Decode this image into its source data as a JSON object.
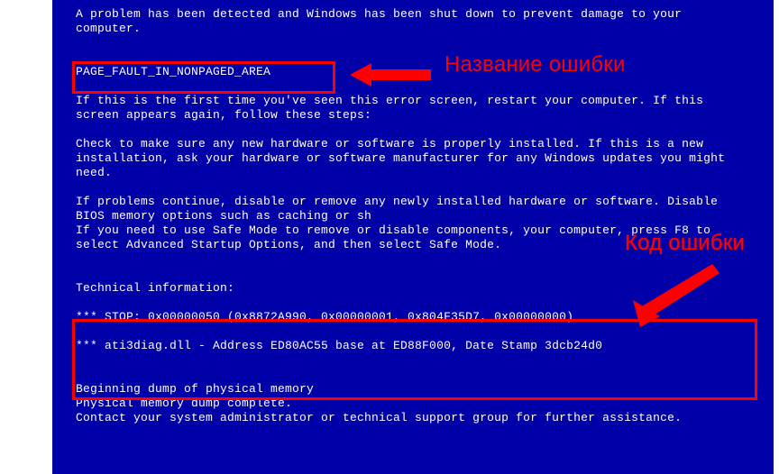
{
  "bsod": {
    "intro": "A problem has been detected and Windows has been shut down to prevent damage to your computer.",
    "error_name": "PAGE_FAULT_IN_NONPAGED_AREA",
    "first_time": "If this is the first time you've seen this error screen, restart your computer. If this screen appears again, follow these steps:",
    "check_hw": "Check to make sure any new hardware or software is properly installed. If this is a new installation, ask your hardware or software manufacturer for any Windows updates you might need.",
    "problems_continue": "If problems continue, disable or remove any newly installed hardware or software. Disable BIOS memory options such as caching or sh",
    "safe_mode": "If you need to use Safe Mode to remove or disable components, your computer, press F8 to select Advanced Startup Options, and then select Safe Mode.",
    "tech_header": "Technical information:",
    "stop_line": "*** STOP: 0x00000050 (0x8872A990, 0x00000001, 0x804F35D7, 0x00000000)",
    "module_line": "*** ati3diag.dll - Address ED80AC55 base at ED88F000, Date Stamp 3dcb24d0",
    "dump_begin": "Beginning dump of physical memory",
    "dump_complete": "Physical memory dump complete.",
    "contact": "Contact your system administrator or technical support group for further assistance."
  },
  "annotations": {
    "error_name_label": "Название ошибки",
    "error_code_label": "Код ошибки"
  },
  "colors": {
    "bg": "#0000a8",
    "text": "#ffffff",
    "annotation": "#ff0000"
  }
}
